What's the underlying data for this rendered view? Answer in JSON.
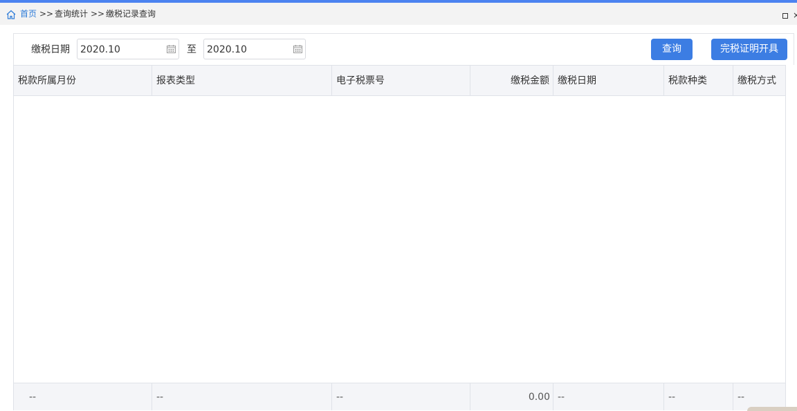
{
  "breadcrumb": {
    "home": "首页",
    "sep1": ">>",
    "query_stats": "查询统计",
    "sep2": ">>",
    "current": "缴税记录查询"
  },
  "window": {
    "restore_icon": "restore-icon",
    "close_glyph": "×"
  },
  "filter": {
    "label": "缴税日期",
    "date_from": "2020.10",
    "to_label": "至",
    "date_to": "2020.10"
  },
  "buttons": {
    "query": "查询",
    "certificate": "完税证明开具"
  },
  "table": {
    "columns": [
      "税款所属月份",
      "报表类型",
      "电子税票号",
      "缴税金额",
      "缴税日期",
      "税款种类",
      "缴税方式"
    ],
    "footer": [
      "--",
      "--",
      "--",
      "0.00",
      "--",
      "--",
      "--"
    ]
  },
  "colors": {
    "accent": "#3c7de3",
    "link": "#2d7bd8",
    "top_bar": "#4b83f0"
  }
}
